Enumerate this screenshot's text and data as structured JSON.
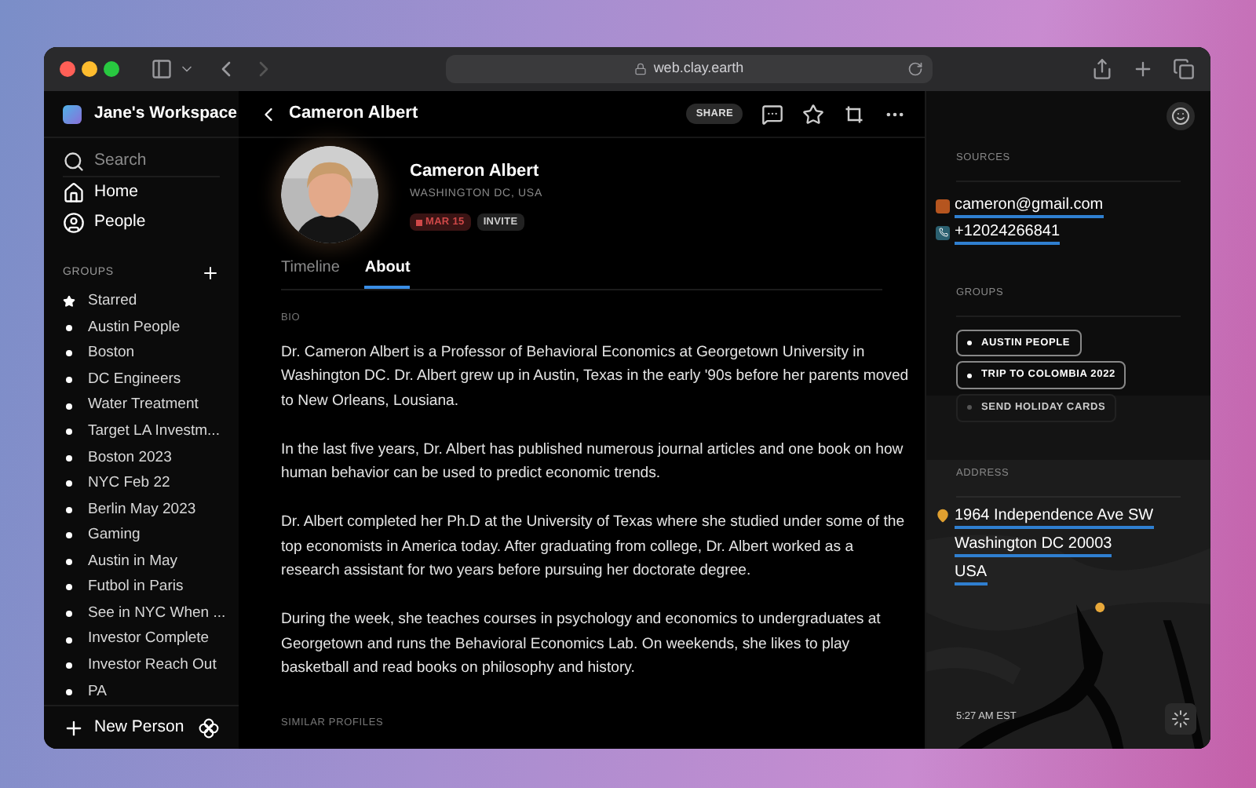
{
  "browser": {
    "url": "web.clay.earth"
  },
  "sidebar": {
    "workspace": "Jane's Workspace",
    "search": {
      "placeholder": "Search"
    },
    "nav": [
      {
        "kind": "home",
        "label": "Home"
      },
      {
        "kind": "people",
        "label": "People"
      }
    ],
    "groups_heading": "GROUPS",
    "groups": [
      {
        "kind": "star",
        "label": "Starred"
      },
      {
        "kind": "dot",
        "label": "Austin People"
      },
      {
        "kind": "dot",
        "label": "Boston"
      },
      {
        "kind": "dot",
        "label": "DC Engineers"
      },
      {
        "kind": "dot",
        "label": "Water Treatment"
      },
      {
        "kind": "dot",
        "label": "Target LA Investm..."
      },
      {
        "kind": "dot",
        "label": "Boston 2023"
      },
      {
        "kind": "dot",
        "label": "NYC Feb 22"
      },
      {
        "kind": "dot",
        "label": "Berlin May 2023"
      },
      {
        "kind": "dot",
        "label": "Gaming"
      },
      {
        "kind": "dot",
        "label": "Austin in May"
      },
      {
        "kind": "dot",
        "label": "Futbol in Paris"
      },
      {
        "kind": "dot",
        "label": "See in NYC When ..."
      },
      {
        "kind": "dot",
        "label": "Investor Complete"
      },
      {
        "kind": "dot",
        "label": "Investor Reach Out"
      },
      {
        "kind": "dot",
        "label": "PA"
      }
    ],
    "new_person": "New Person"
  },
  "header": {
    "title": "Cameron Albert",
    "share": "SHARE"
  },
  "profile": {
    "name": "Cameron Albert",
    "location": "WASHINGTON DC, USA",
    "date_badge": "MAR 15",
    "invite": "INVITE"
  },
  "tabs": [
    {
      "label": "Timeline",
      "selected": false
    },
    {
      "label": "About",
      "selected": true
    }
  ],
  "bio": {
    "heading": "BIO",
    "paragraphs": [
      "Dr. Cameron Albert is a Professor of Behavioral Economics at Georgetown University in Washington DC. Dr. Albert grew up in Austin, Texas in the early '90s before her parents moved to New Orleans, Lousiana.",
      "In the last five years, Dr. Albert has published numerous journal articles and one book on how human behavior can be used to predict economic trends.",
      "Dr. Albert completed her Ph.D at the University of Texas where she studied under some of the top economists in America today. After graduating from college, Dr. Albert worked as a research assistant for two years before pursuing her doctorate degree.",
      "During the week, she teaches courses in psychology and economics to undergraduates at Georgetown and runs the Behavioral Economics Lab. On weekends, she likes to play basketball and read books on philosophy and history."
    ]
  },
  "similar_heading": "SIMILAR PROFILES",
  "details": {
    "sources_heading": "SOURCES",
    "sources": [
      {
        "kind": "mail",
        "value": "cameron@gmail.com"
      },
      {
        "kind": "phone",
        "value": "+12024266841"
      }
    ],
    "groups_heading": "GROUPS",
    "groups": [
      {
        "label": "AUSTIN PEOPLE",
        "active": true
      },
      {
        "label": "TRIP TO COLOMBIA 2022",
        "active": true
      },
      {
        "label": "SEND HOLIDAY CARDS",
        "active": false
      }
    ],
    "address_heading": "ADDRESS",
    "address_lines": [
      "1964 Independence Ave SW",
      "Washington DC 20003",
      "USA"
    ],
    "map": {
      "kind": "picture"
    },
    "time": "5:27 AM EST"
  }
}
